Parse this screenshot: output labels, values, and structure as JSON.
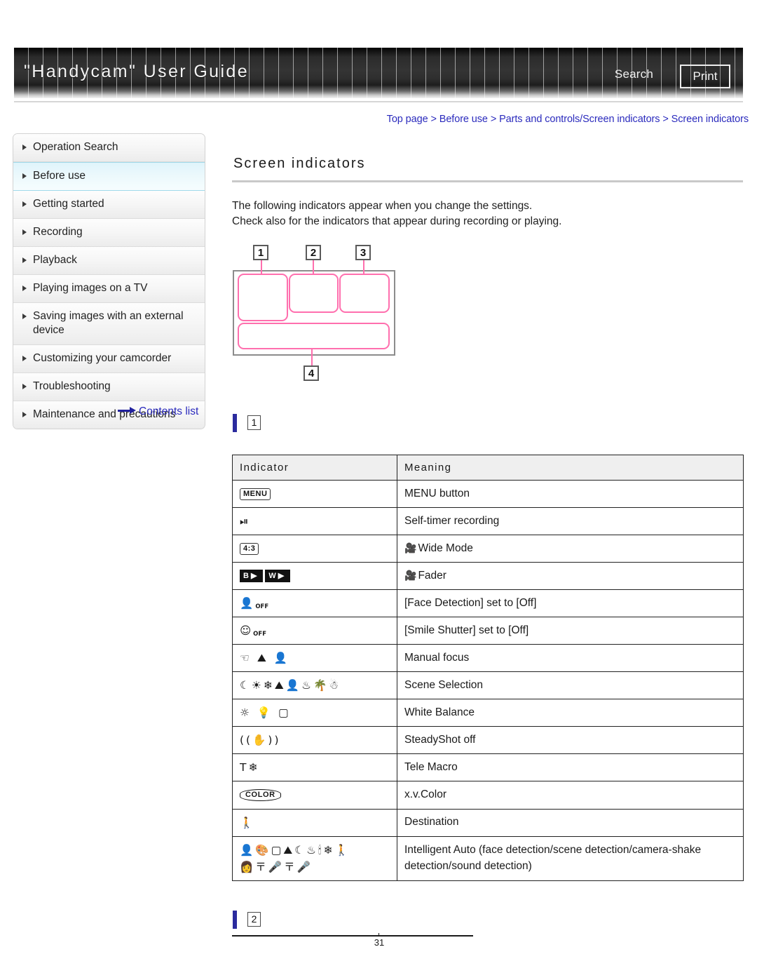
{
  "header": {
    "title": "\"Handycam\" User Guide",
    "search_label": "Search",
    "print_label": "Print"
  },
  "breadcrumb": {
    "text": "Top page > Before use > Parts and controls/Screen indicators > Screen indicators"
  },
  "sidebar": {
    "items": [
      {
        "label": "Operation Search",
        "selected": false
      },
      {
        "label": "Before use",
        "selected": true
      },
      {
        "label": "Getting started",
        "selected": false
      },
      {
        "label": "Recording",
        "selected": false
      },
      {
        "label": "Playback",
        "selected": false
      },
      {
        "label": "Playing images on a TV",
        "selected": false
      },
      {
        "label": "Saving images with an external device",
        "selected": false
      },
      {
        "label": "Customizing your camcorder",
        "selected": false
      },
      {
        "label": "Troubleshooting",
        "selected": false
      },
      {
        "label": "Maintenance and precautions",
        "selected": false
      }
    ],
    "contents_link": "Contents list"
  },
  "main": {
    "title": "Screen indicators",
    "intro_line1": "The following indicators appear when you change the settings.",
    "intro_line2": "Check also for the indicators that appear during recording or playing.",
    "diagram": {
      "callouts": [
        "1",
        "2",
        "3",
        "4"
      ]
    },
    "section_marker_1": "1",
    "section_marker_2": "2",
    "table": {
      "headers": [
        "Indicator",
        "Meaning"
      ],
      "rows": [
        {
          "icon": "menu-button-icon",
          "meaning": "MENU button"
        },
        {
          "icon": "self-timer-icon",
          "meaning": "Self-timer recording"
        },
        {
          "icon": "aspect-ratio-4-3-icon",
          "meaning": "Wide Mode"
        },
        {
          "icon": "fader-black-white-icon",
          "meaning": "Fader"
        },
        {
          "icon": "face-detection-off-icon",
          "meaning": "[Face Detection] set to [Off]"
        },
        {
          "icon": "smile-shutter-off-icon",
          "meaning": "[Smile Shutter] set to [Off]"
        },
        {
          "icon": "manual-focus-icon",
          "meaning": "Manual focus"
        },
        {
          "icon": "scene-selection-icons",
          "meaning": "Scene Selection"
        },
        {
          "icon": "white-balance-icons",
          "meaning": "White Balance"
        },
        {
          "icon": "steadyshot-off-icon",
          "meaning": "SteadyShot off"
        },
        {
          "icon": "tele-macro-icon",
          "meaning": "Tele Macro"
        },
        {
          "icon": "xv-color-icon",
          "meaning": "x.v.Color"
        },
        {
          "icon": "destination-icon",
          "meaning": "Destination"
        },
        {
          "icon": "intelligent-auto-icons",
          "meaning": "Intelligent Auto (face detection/scene detection/camera-shake detection/sound detection)"
        }
      ]
    }
  },
  "footer": {
    "page_number": "31"
  },
  "colors": {
    "link": "#2b2bbd",
    "accent_pink": "#ff6fae",
    "marker_blue": "#2b2b9e",
    "selected_nav": "#dff4fb"
  }
}
